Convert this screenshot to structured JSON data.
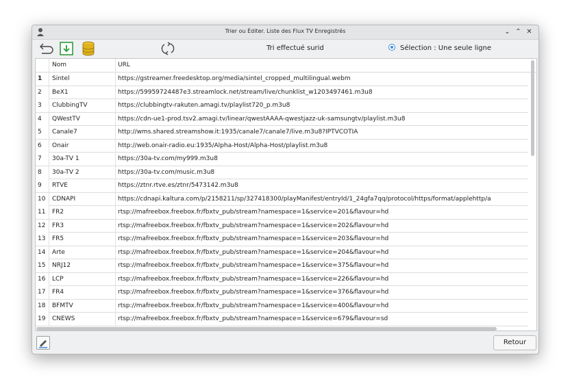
{
  "window": {
    "title": "Trier ou Éditer. Liste des Flux TV Enregistrés",
    "controls": {
      "minimize": "⌄",
      "maximize": "⌃",
      "close": "✕"
    }
  },
  "toolbar": {
    "icons": [
      "back-arrow-icon",
      "save-download-icon",
      "database-icon",
      "refresh-icon"
    ],
    "status_text": "Tri effectué surid",
    "selection_label": "Sélection : Une seule ligne",
    "colors": {
      "download_green": "#2e9b3a",
      "db_yellow": "#e0b21a",
      "radio_blue": "#3d8ae0"
    }
  },
  "table": {
    "headers": {
      "num": "",
      "name": "Nom",
      "url": "URL"
    },
    "rows": [
      {
        "num": "1",
        "name": "Sintel",
        "url": "https://gstreamer.freedesktop.org/media/sintel_cropped_multilingual.webm"
      },
      {
        "num": "2",
        "name": "BeX1",
        "url": "https://59959724487e3.streamlock.net/stream/live/chunklist_w1203497461.m3u8"
      },
      {
        "num": "3",
        "name": "ClubbingTV",
        "url": "https://clubbingtv-rakuten.amagi.tv/playlist720_p.m3u8"
      },
      {
        "num": "4",
        "name": "QWestTV",
        "url": "https://cdn-ue1-prod.tsv2.amagi.tv/linear/qwestAAAA-qwestjazz-uk-samsungtv/playlist.m3u8"
      },
      {
        "num": "5",
        "name": "Canale7",
        "url": "http://wms.shared.streamshow.it:1935/canale7/canale7/live.m3u8?IPTVCOTIA"
      },
      {
        "num": "6",
        "name": "Onair",
        "url": "http://web.onair-radio.eu:1935/Alpha-Host/Alpha-Host/playlist.m3u8"
      },
      {
        "num": "7",
        "name": "30a-TV 1",
        "url": "https://30a-tv.com/my999.m3u8"
      },
      {
        "num": "8",
        "name": "30a-TV 2",
        "url": "https://30a-tv.com/music.m3u8"
      },
      {
        "num": "9",
        "name": "RTVE",
        "url": "https://ztnr.rtve.es/ztnr/5473142.m3u8"
      },
      {
        "num": "10",
        "name": "CDNAPI",
        "url": "https://cdnapi.kaltura.com/p/2158211/sp/327418300/playManifest/entryId/1_24gfa7qq/protocol/https/format/applehttp/a"
      },
      {
        "num": "11",
        "name": "FR2",
        "url": "rtsp://mafreebox.freebox.fr/fbxtv_pub/stream?namespace=1&service=201&flavour=hd"
      },
      {
        "num": "12",
        "name": "FR3",
        "url": "rtsp://mafreebox.freebox.fr/fbxtv_pub/stream?namespace=1&service=202&flavour=hd"
      },
      {
        "num": "13",
        "name": "FR5",
        "url": "rtsp://mafreebox.freebox.fr/fbxtv_pub/stream?namespace=1&service=203&flavour=hd"
      },
      {
        "num": "14",
        "name": "Arte",
        "url": "rtsp://mafreebox.freebox.fr/fbxtv_pub/stream?namespace=1&service=204&flavour=hd"
      },
      {
        "num": "15",
        "name": "NRJ12",
        "url": "rtsp://mafreebox.freebox.fr/fbxtv_pub/stream?namespace=1&service=375&flavour=hd"
      },
      {
        "num": "16",
        "name": "LCP",
        "url": "rtsp://mafreebox.freebox.fr/fbxtv_pub/stream?namespace=1&service=226&flavour=hd"
      },
      {
        "num": "17",
        "name": "FR4",
        "url": "rtsp://mafreebox.freebox.fr/fbxtv_pub/stream?namespace=1&service=376&flavour=hd"
      },
      {
        "num": "18",
        "name": "BFMTV",
        "url": "rtsp://mafreebox.freebox.fr/fbxtv_pub/stream?namespace=1&service=400&flavour=hd"
      },
      {
        "num": "19",
        "name": "CNEWS",
        "url": "rtsp://mafreebox.freebox.fr/fbxtv_pub/stream?namespace=1&service=679&flavour=sd"
      }
    ]
  },
  "footer": {
    "edit_icon": "edit-icon",
    "back_button_label": "Retour"
  }
}
